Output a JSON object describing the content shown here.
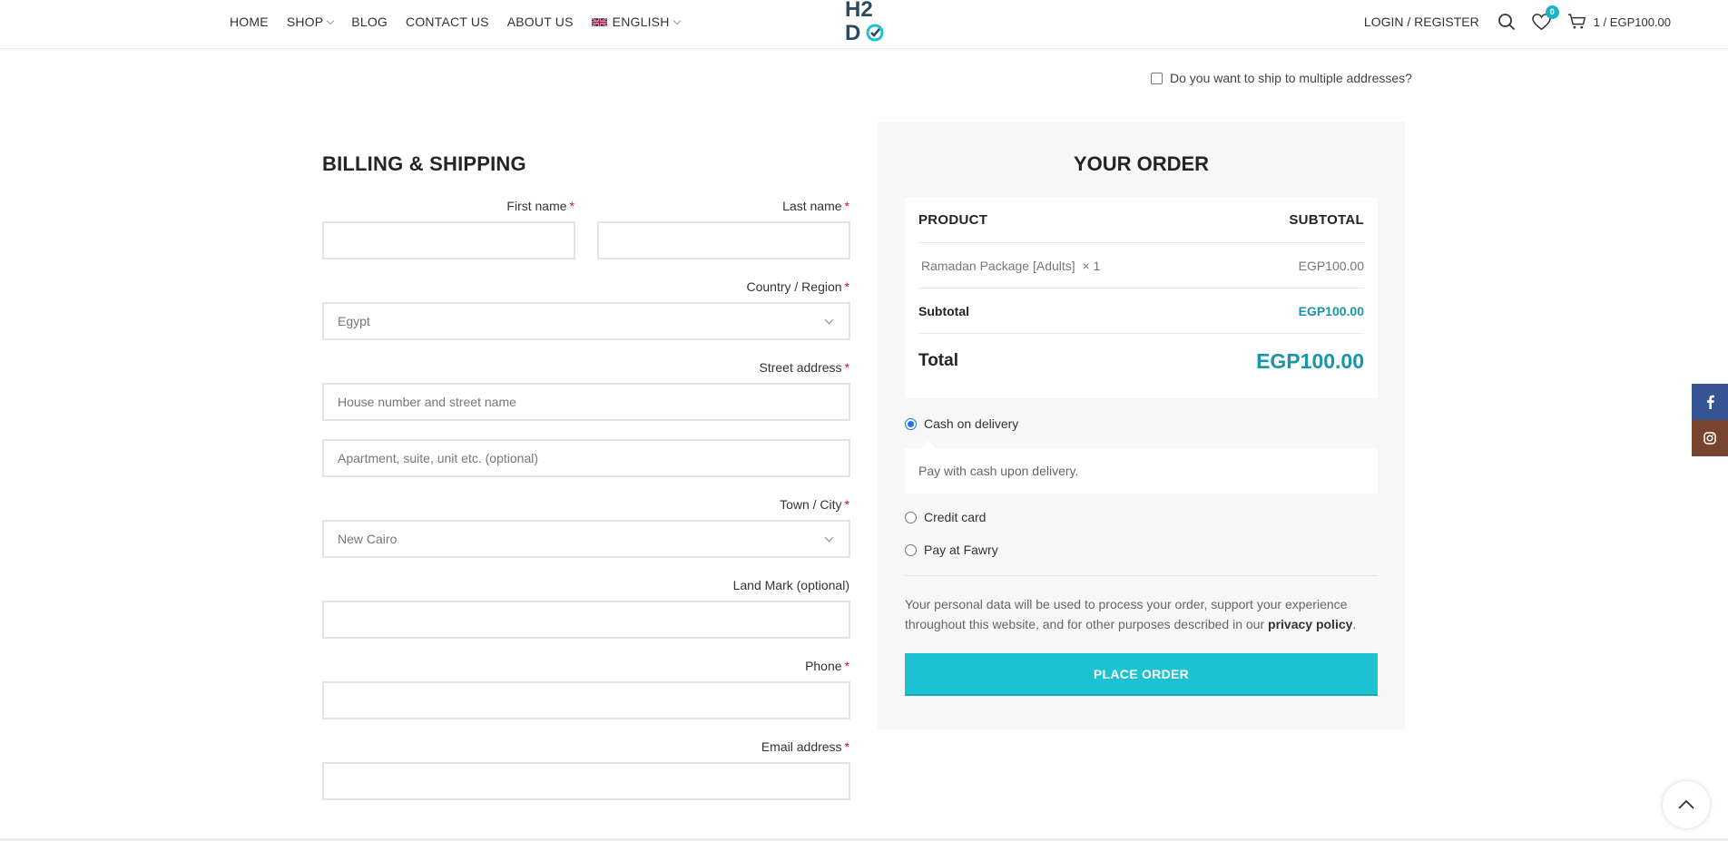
{
  "header": {
    "nav": [
      {
        "label": "HOME",
        "dropdown": false
      },
      {
        "label": "SHOP",
        "dropdown": true
      },
      {
        "label": "BLOG",
        "dropdown": false
      },
      {
        "label": "CONTACT US",
        "dropdown": false
      },
      {
        "label": "ABOUT US",
        "dropdown": false
      }
    ],
    "language": "ENGLISH",
    "logo_text": "H2DO",
    "login": "LOGIN / REGISTER",
    "wishlist_count": "0",
    "cart_text": "1 / EGP100.00"
  },
  "multi_ship": "Do you want to ship to multiple addresses?",
  "billing": {
    "title": "BILLING & SHIPPING",
    "first_name": "First name",
    "last_name": "Last name",
    "country_label": "Country / Region",
    "country_value": "Egypt",
    "street_label": "Street address",
    "street_placeholder": "House number and street name",
    "apartment_placeholder": "Apartment, suite, unit etc. (optional)",
    "city_label": "Town / City",
    "city_value": "New Cairo",
    "landmark_label": "Land Mark (optional)",
    "phone_label": "Phone",
    "email_label": "Email address",
    "required_mark": "*"
  },
  "order": {
    "title": "YOUR ORDER",
    "col_product": "PRODUCT",
    "col_subtotal": "SUBTOTAL",
    "item_name": "Ramadan Package [Adults]",
    "item_qty": "× 1",
    "item_price": "EGP100.00",
    "subtotal_label": "Subtotal",
    "subtotal_value": "EGP100.00",
    "total_label": "Total",
    "total_value": "EGP100.00",
    "payment": {
      "cod": "Cash on delivery",
      "cod_desc": "Pay with cash upon delivery.",
      "credit": "Credit card",
      "fawry": "Pay at Fawry"
    },
    "privacy_text": "Your personal data will be used to process your order, support your experience throughout this website, and for other purposes described in our",
    "privacy_link": "privacy policy",
    "privacy_end": ".",
    "place_order": "PLACE ORDER"
  },
  "colors": {
    "accent": "#1dc2d2",
    "price_teal": "#1896ab",
    "facebook": "#365493",
    "instagram": "#774430"
  }
}
